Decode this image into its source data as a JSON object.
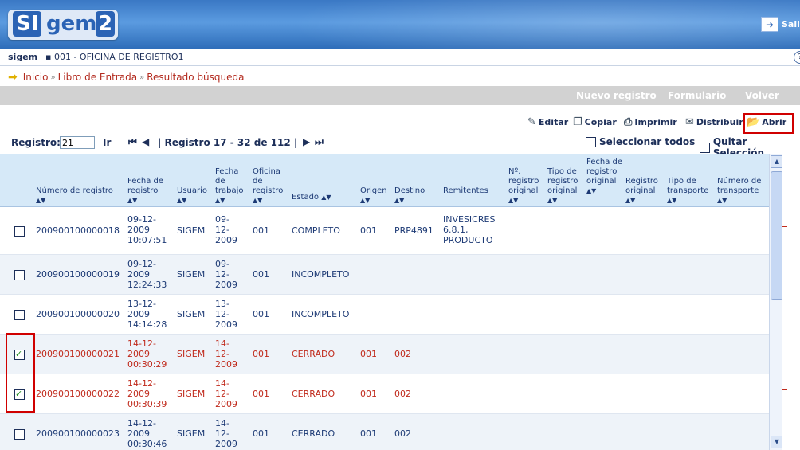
{
  "app": {
    "logo_si": "SI",
    "logo_gem": "gem",
    "logo_num": "2",
    "exit_label": "Sali"
  },
  "userbar": {
    "user": "sigem",
    "office": "▪ 001 - OFICINA DE REGISTRO1",
    "help": "?"
  },
  "breadcrumb": [
    "Inicio",
    "Libro de Entrada",
    "Resultado búsqueda"
  ],
  "actions": {
    "new": "Nuevo registro",
    "form": "Formulario",
    "back": "Volver"
  },
  "toolbar": {
    "edit": "Editar",
    "copy": "Copiar",
    "print": "Imprimir",
    "distribute": "Distribuir",
    "open": "Abrir"
  },
  "nav": {
    "registro_label": "Registro:",
    "registro_value": "21",
    "go": "Ir",
    "range": "| Registro 17 - 32 de 112 |",
    "select_all": "Seleccionar todos",
    "deselect": "Quitar Selección"
  },
  "columns": [
    "Número de registro",
    "Fecha de registro",
    "Usuario",
    "Fecha de trabajo",
    "Oficina de registro",
    "Estado",
    "Origen",
    "Destino",
    "Remitentes",
    "Nº. registro original",
    "Tipo de registro original",
    "Fecha de registro original",
    "Registro original",
    "Tipo de transporte",
    "Número de transporte"
  ],
  "rows": [
    {
      "num": "200900100000018",
      "fecha": "09-12-2009 10:07:51",
      "usuario": "SIGEM",
      "trabajo": "09-12-2009",
      "oficina": "001",
      "estado": "COMPLETO",
      "origen": "001",
      "destino": "PRP4891",
      "remitentes": "INVESICRES 6.8.1, PRODUCTO",
      "checked": false,
      "red": false
    },
    {
      "num": "200900100000019",
      "fecha": "09-12-2009 12:24:33",
      "usuario": "SIGEM",
      "trabajo": "09-12-2009",
      "oficina": "001",
      "estado": "INCOMPLETO",
      "origen": "",
      "destino": "",
      "remitentes": "",
      "checked": false,
      "red": false
    },
    {
      "num": "200900100000020",
      "fecha": "13-12-2009 14:14:28",
      "usuario": "SIGEM",
      "trabajo": "13-12-2009",
      "oficina": "001",
      "estado": "INCOMPLETO",
      "origen": "",
      "destino": "",
      "remitentes": "",
      "checked": false,
      "red": false
    },
    {
      "num": "200900100000021",
      "fecha": "14-12-2009 00:30:29",
      "usuario": "SIGEM",
      "trabajo": "14-12-2009",
      "oficina": "001",
      "estado": "CERRADO",
      "origen": "001",
      "destino": "002",
      "remitentes": "",
      "checked": true,
      "red": true
    },
    {
      "num": "200900100000022",
      "fecha": "14-12-2009 00:30:39",
      "usuario": "SIGEM",
      "trabajo": "14-12-2009",
      "oficina": "001",
      "estado": "CERRADO",
      "origen": "001",
      "destino": "002",
      "remitentes": "",
      "checked": true,
      "red": true
    },
    {
      "num": "200900100000023",
      "fecha": "14-12-2009 00:30:46",
      "usuario": "SIGEM",
      "trabajo": "14-12-2009",
      "oficina": "001",
      "estado": "CERRADO",
      "origen": "001",
      "destino": "002",
      "remitentes": "",
      "checked": false,
      "red": false
    }
  ]
}
